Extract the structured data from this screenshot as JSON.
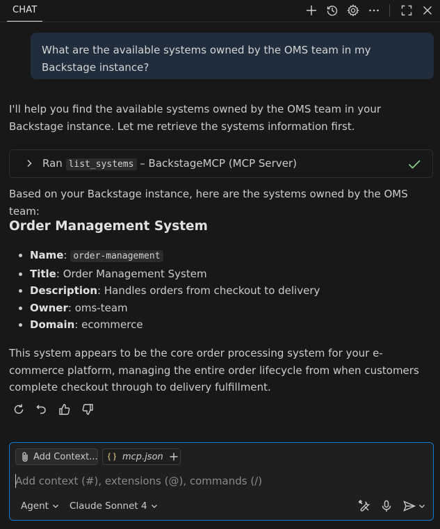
{
  "header": {
    "tab_label": "CHAT",
    "icons": [
      "plus-icon",
      "history-icon",
      "gear-icon",
      "more-icon",
      "maximize-icon",
      "close-icon"
    ]
  },
  "user_message": "What are the available systems owned by the OMS team in my Backstage instance?",
  "response": {
    "intro": "I'll help you find the available systems owned by the OMS team in your Backstage instance. Let me retrieve the systems information first.",
    "tool_call": {
      "prefix": "Ran",
      "tool_name": "list_systems",
      "suffix": "– BackstageMCP (MCP Server)",
      "status": "success"
    },
    "summary": "Based on your Backstage instance, here are the systems owned by the OMS team:",
    "heading": "Order Management System",
    "fields": [
      {
        "key": "Name",
        "value": "order-management",
        "code": true
      },
      {
        "key": "Title",
        "value": "Order Management System"
      },
      {
        "key": "Description",
        "value": "Handles orders from checkout to delivery"
      },
      {
        "key": "Owner",
        "value": "oms-team"
      },
      {
        "key": "Domain",
        "value": "ecommerce"
      }
    ],
    "closing": "This system appears to be the core order processing system for your e-commerce platform, managing the entire order lifecycle from when customers complete checkout through to delivery fulfillment."
  },
  "input": {
    "add_context_label": "Add Context...",
    "file_chip_label": "mcp.json",
    "placeholder": "Add context (#), extensions (@), commands (/)",
    "value": "",
    "mode_label": "Agent",
    "model_label": "Claude Sonnet 4"
  },
  "colors": {
    "background": "#181818",
    "user_bubble": "#1f2d3d",
    "focus_border": "#0e7ad3",
    "success": "#89d185",
    "json_icon": "#d7ba7d"
  }
}
